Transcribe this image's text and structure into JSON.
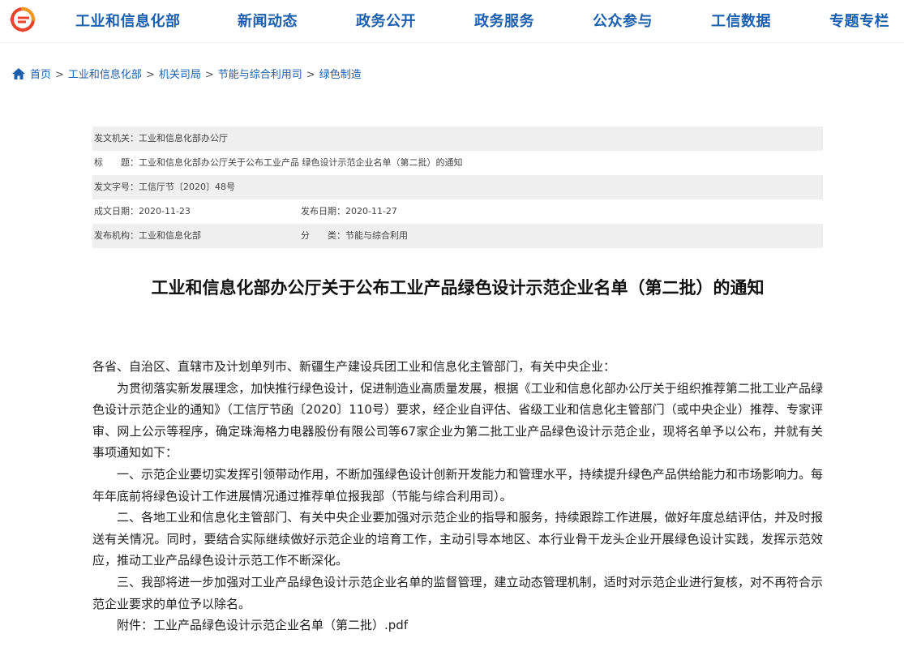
{
  "nav": {
    "items": [
      "工业和信息化部",
      "新闻动态",
      "政务公开",
      "政务服务",
      "公众参与",
      "工信数据",
      "专题专栏"
    ]
  },
  "breadcrumb": {
    "items": [
      "首页",
      "工业和信息化部",
      "机关司局",
      "节能与综合利用司",
      "绿色制造"
    ],
    "separator": ">"
  },
  "meta": {
    "issuer_label": "发文机关：",
    "issuer_value": "工业和信息化部办公厅",
    "title_label": "标　　题：",
    "title_value": "工业和信息化部办公厅关于公布工业产品 绿色设计示范企业名单（第二批）的通知",
    "docno_label": "发文字号：",
    "docno_value": "工信厅节〔2020〕48号",
    "created_label": "成文日期：",
    "created_value": "2020-11-23",
    "published_label": "发布日期：",
    "published_value": "2020-11-27",
    "org_label": "发布机构：",
    "org_value": "工业和信息化部",
    "category_label": "分　　类：",
    "category_value": "节能与综合利用"
  },
  "doc": {
    "title": "工业和信息化部办公厅关于公布工业产品绿色设计示范企业名单（第二批）的通知",
    "salutation": "各省、自治区、直辖市及计划单列市、新疆生产建设兵团工业和信息化主管部门，有关中央企业：",
    "para1": "为贯彻落实新发展理念，加快推行绿色设计，促进制造业高质量发展，根据《工业和信息化部办公厅关于组织推荐第二批工业产品绿色设计示范企业的通知》（工信厅节函〔2020〕110号）要求，经企业自评估、省级工业和信息化主管部门（或中央企业）推荐、专家评审、网上公示等程序，确定珠海格力电器股份有限公司等67家企业为第二批工业产品绿色设计示范企业，现将名单予以公布，并就有关事项通知如下：",
    "para2": "一、示范企业要切实发挥引领带动作用，不断加强绿色设计创新开发能力和管理水平，持续提升绿色产品供给能力和市场影响力。每年年底前将绿色设计工作进展情况通过推荐单位报我部（节能与综合利用司）。",
    "para3": "二、各地工业和信息化主管部门、有关中央企业要加强对示范企业的指导和服务，持续跟踪工作进展，做好年度总结评估，并及时报送有关情况。同时，要结合实际继续做好示范企业的培育工作，主动引导本地区、本行业骨干龙头企业开展绿色设计实践，发挥示范效应，推动工业产品绿色设计示范工作不断深化。",
    "para4": "三、我部将进一步加强对工业产品绿色设计示范企业名单的监督管理，建立动态管理机制，适时对示范企业进行复核，对不再符合示范企业要求的单位予以除名。",
    "attachment_label": "附件：",
    "attachment_link": "工业产品绿色设计示范企业名单（第二批）.pdf"
  },
  "colors": {
    "nav_text": "#1b5fae",
    "logo_red": "#e8452c",
    "logo_orange": "#f39a1e",
    "meta_shade": "#efefef"
  },
  "icons": {
    "logo": "miit-logo-icon",
    "home": "home-icon"
  }
}
